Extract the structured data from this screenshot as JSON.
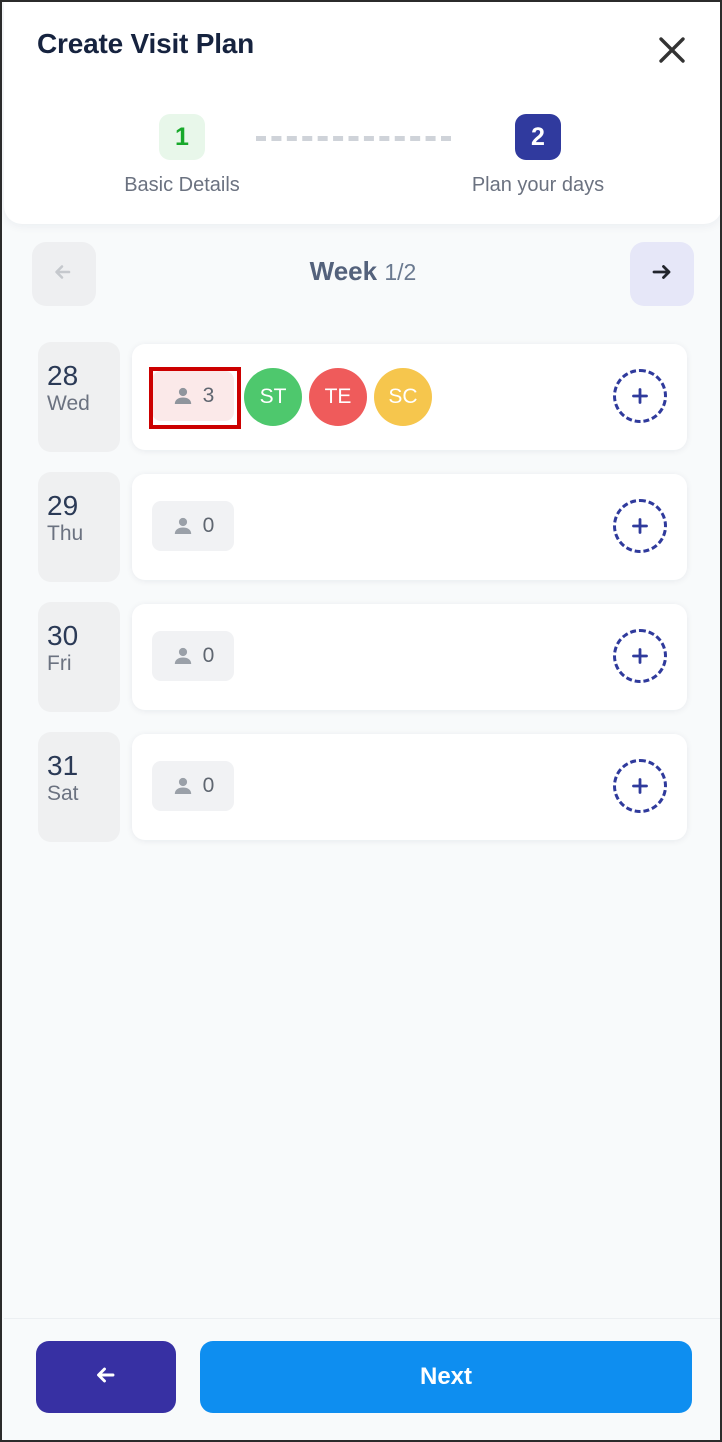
{
  "header": {
    "title": "Create Visit Plan",
    "close_icon": "close-icon"
  },
  "stepper": {
    "steps": [
      {
        "number": "1",
        "label": "Basic Details",
        "state": "done"
      },
      {
        "number": "2",
        "label": "Plan your days",
        "state": "active"
      }
    ]
  },
  "week_nav": {
    "prev_icon": "arrow-left-icon",
    "next_icon": "arrow-right-icon",
    "title": "Week",
    "fraction": "1/2"
  },
  "days": [
    {
      "date": "28",
      "dow": "Wed",
      "count": "3",
      "count_state": "filled",
      "selected": true,
      "avatars": [
        {
          "initials": "ST",
          "color": "#4ec86d"
        },
        {
          "initials": "TE",
          "color": "#ef5b5b"
        },
        {
          "initials": "SC",
          "color": "#f6c64d"
        }
      ],
      "add_icon": "add-plus-icon"
    },
    {
      "date": "29",
      "dow": "Thu",
      "count": "0",
      "count_state": "zero",
      "selected": false,
      "avatars": [],
      "add_icon": "add-plus-icon"
    },
    {
      "date": "30",
      "dow": "Fri",
      "count": "0",
      "count_state": "zero",
      "selected": false,
      "avatars": [],
      "add_icon": "add-plus-icon"
    },
    {
      "date": "31",
      "dow": "Sat",
      "count": "0",
      "count_state": "zero",
      "selected": false,
      "avatars": [],
      "add_icon": "add-plus-icon"
    }
  ],
  "footer": {
    "back_icon": "arrow-left-icon",
    "next_label": "Next"
  },
  "colors": {
    "accent_next": "#0e8ef0",
    "accent_back": "#3730a3",
    "step_done": "#17a92b",
    "step_active_bg": "#303a9e",
    "selection_outline": "#cc0000"
  }
}
